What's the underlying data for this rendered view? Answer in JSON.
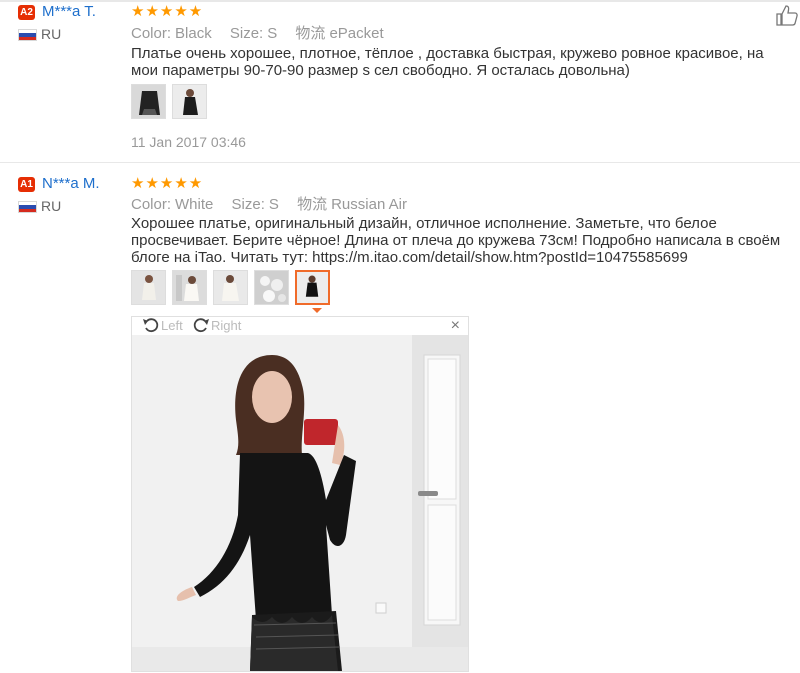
{
  "reviews": [
    {
      "badge": "A2",
      "user": "M***a T.",
      "country": "RU",
      "stars": "★★★★★",
      "color_label": "Color:",
      "color_value": "Black",
      "size_label": "Size:",
      "size_value": "S",
      "shipping_label": "物流",
      "shipping_value": "ePacket",
      "text": "Платье очень хорошее, плотное, тёплое , доставка быстрая, кружево ровное красивое, на мои параметры 90-70-90 размер s сел свободно. Я осталась довольна)",
      "date": "11 Jan 2017 03:46"
    },
    {
      "badge": "A1",
      "user": "N***a M.",
      "country": "RU",
      "stars": "★★★★★",
      "color_label": "Color:",
      "color_value": "White",
      "size_label": "Size:",
      "size_value": "S",
      "shipping_label": "物流",
      "shipping_value": "Russian Air",
      "text": "Хорошее платье, оригинальный дизайн, отличное исполнение. Заметьте, что белое просвечивает. Берите чёрное! Длина от плеча до кружева 73см! Подробно написала в своём блоге на iTao. Читать тут: https://m.itao.com/detail/show.htm?postId=10475585699"
    }
  ],
  "viewer": {
    "rotate_left": "Left",
    "rotate_right": "Right",
    "close": "×"
  },
  "colors": {
    "accent": "#f06b2a",
    "link": "#1e6fcc",
    "star": "#ff9900",
    "badge": "#e62e04"
  }
}
